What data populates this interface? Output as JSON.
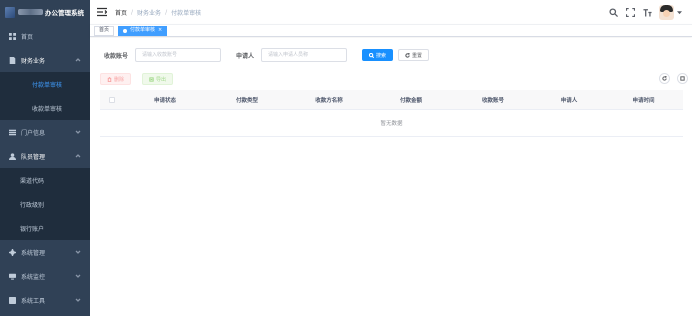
{
  "brand": {
    "title": "办公管理系统"
  },
  "sidebar": {
    "items": [
      {
        "label": "首页",
        "icon": "dashboard-icon"
      },
      {
        "label": "财务业务",
        "icon": "document-icon",
        "open": true,
        "children": [
          {
            "label": "付款单审核",
            "active": true
          },
          {
            "label": "收款单审核",
            "active": false
          }
        ]
      },
      {
        "label": "门户信息",
        "icon": "list-icon"
      },
      {
        "label": "队员管理",
        "icon": "user-icon",
        "open": true,
        "children": [
          {
            "label": "渠道代码"
          },
          {
            "label": "行政级别"
          },
          {
            "label": "银行账户"
          }
        ]
      },
      {
        "label": "系统管理",
        "icon": "gear-icon"
      },
      {
        "label": "系统监控",
        "icon": "monitor-icon"
      },
      {
        "label": "系统工具",
        "icon": "tool-icon"
      }
    ]
  },
  "header": {
    "breadcrumb": [
      "首页",
      "财务业务",
      "付款单审核"
    ]
  },
  "tags": {
    "items": [
      {
        "label": "首页",
        "active": false
      },
      {
        "label": "付款单审核",
        "active": true,
        "close": "×"
      }
    ]
  },
  "search": {
    "field1_label": "收款账号",
    "field1_placeholder": "请输入收款账号",
    "field2_label": "申请人",
    "field2_placeholder": "请输入申请人员称",
    "search_btn": "搜索",
    "reset_btn": "重置"
  },
  "actions": {
    "delete_btn": "删除",
    "export_btn": "导出"
  },
  "table": {
    "columns": [
      "申请状态",
      "付款类型",
      "收款方名称",
      "付款金额",
      "收款账号",
      "申请人",
      "申请时间"
    ],
    "empty_text": "暂无数据"
  },
  "colors": {
    "sidebar_bg": "#304156",
    "primary": "#1890ff",
    "active_menu": "#409eff"
  }
}
